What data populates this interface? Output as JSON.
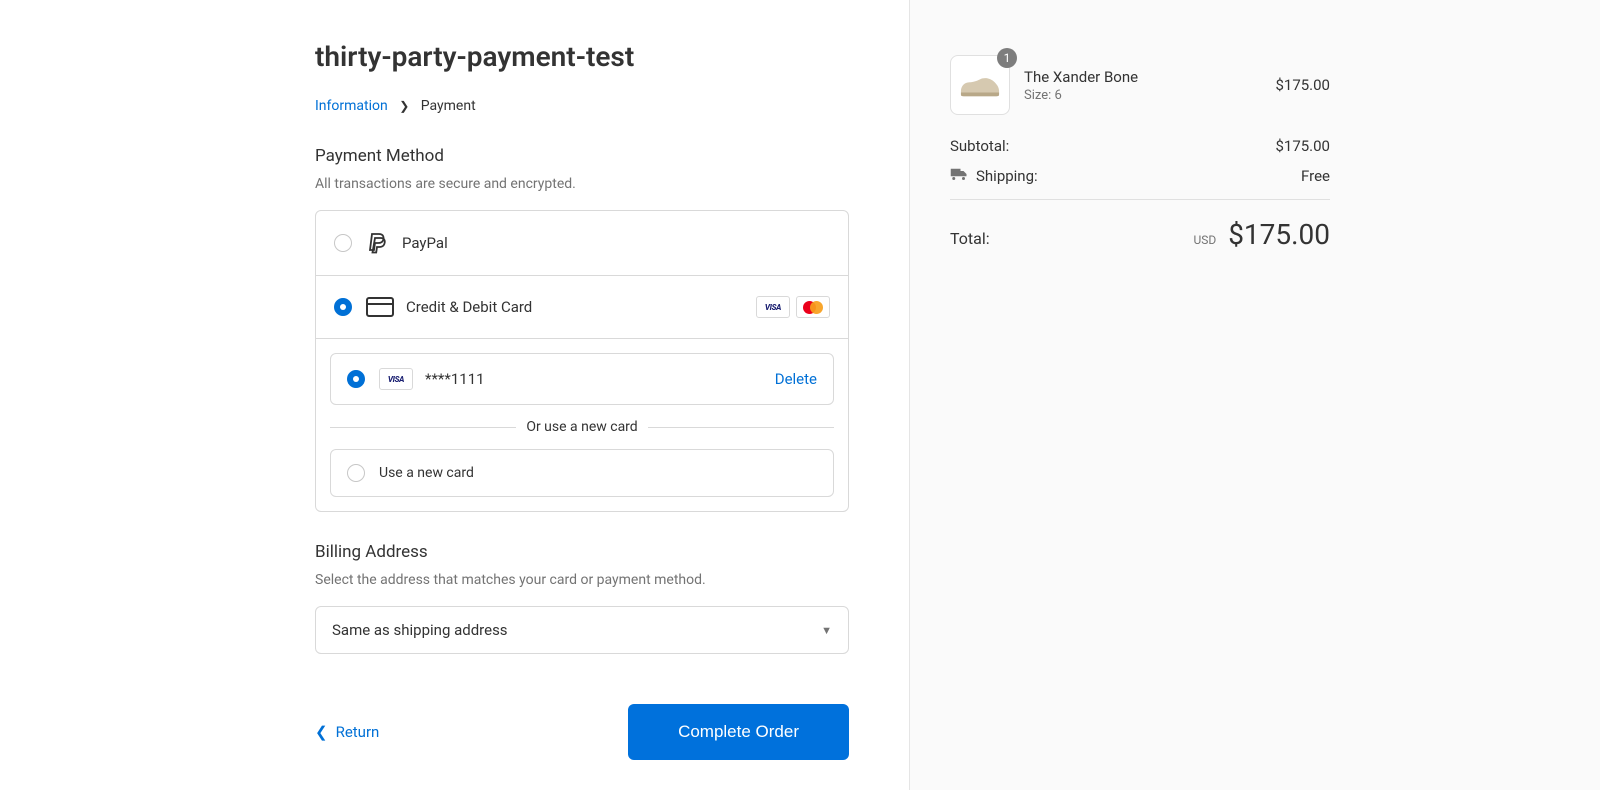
{
  "header": {
    "title": "thirty-party-payment-test"
  },
  "breadcrumb": {
    "information": "Information",
    "payment": "Payment"
  },
  "payment": {
    "title": "Payment Method",
    "subtitle": "All transactions are secure and encrypted.",
    "paypal_label": "PayPal",
    "credit_label": "Credit & Debit Card",
    "saved_card_mask": "****1111",
    "delete_label": "Delete",
    "divider_text": "Or use a new card",
    "new_card_label": "Use a new card"
  },
  "billing": {
    "title": "Billing Address",
    "subtitle": "Select the address that matches your card or payment method.",
    "selected": "Same as shipping address"
  },
  "footer": {
    "return": "Return",
    "complete": "Complete Order"
  },
  "cart": {
    "item": {
      "qty": "1",
      "name": "The Xander Bone",
      "variant": "Size: 6",
      "price": "$175.00"
    },
    "subtotal_label": "Subtotal:",
    "subtotal_value": "$175.00",
    "shipping_label": "Shipping:",
    "shipping_value": "Free",
    "total_label": "Total:",
    "currency": "USD",
    "total_value": "$175.00"
  }
}
